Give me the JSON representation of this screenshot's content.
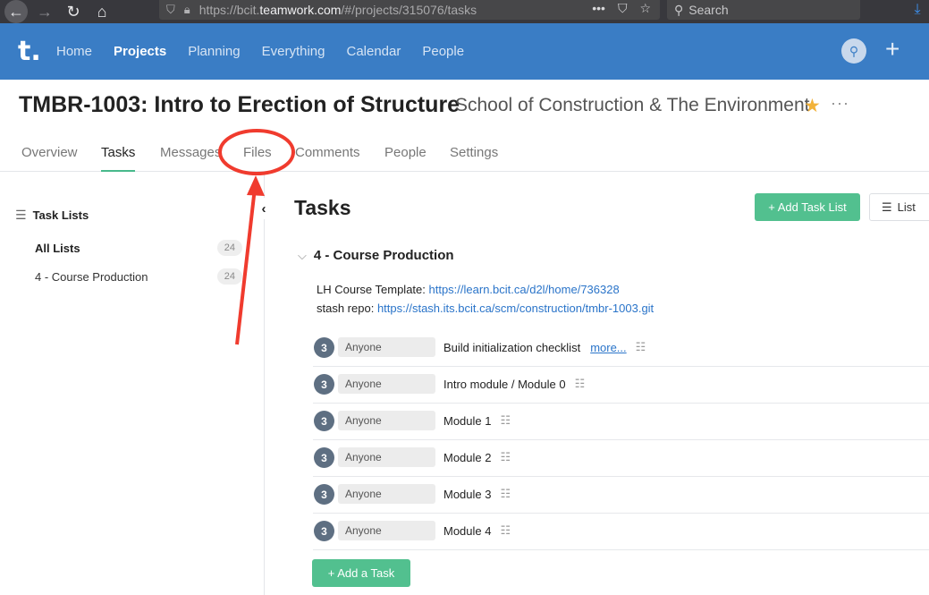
{
  "browser": {
    "back_icon": "←",
    "forward_icon": "→",
    "reload_icon": "↻",
    "home_icon": "⌂",
    "url_prefix": "https://bcit.",
    "url_domain": "teamwork.com",
    "url_rest": "/#/projects/315076/tasks",
    "url_actions": [
      "•••",
      "⛉",
      "☆"
    ],
    "search_placeholder": "Search",
    "download_icon": "⤓"
  },
  "header": {
    "logo": "t.",
    "nav": [
      {
        "label": "Home",
        "active": false
      },
      {
        "label": "Projects",
        "active": true
      },
      {
        "label": "Planning",
        "active": false
      },
      {
        "label": "Everything",
        "active": false
      },
      {
        "label": "Calendar",
        "active": false
      },
      {
        "label": "People",
        "active": false
      }
    ],
    "plus": "+"
  },
  "project": {
    "title": "TMBR-1003: Intro to Erection of Structure",
    "company": "School of Construction & The Environment",
    "star": "★",
    "more": "···"
  },
  "tabs": [
    {
      "label": "Overview",
      "active": false
    },
    {
      "label": "Tasks",
      "active": true
    },
    {
      "label": "Messages",
      "active": false
    },
    {
      "label": "Files",
      "active": false
    },
    {
      "label": "Comments",
      "active": false
    },
    {
      "label": "People",
      "active": false
    },
    {
      "label": "Settings",
      "active": false
    }
  ],
  "sidebar": {
    "heading": "Task Lists",
    "items": [
      {
        "label": "All Lists",
        "count": "24"
      },
      {
        "label": "4 - Course Production",
        "count": "24"
      }
    ],
    "collapse": "‹"
  },
  "main": {
    "title": "Tasks",
    "add_list_label": "+ Add Task List",
    "view_label": "List",
    "tasklist": {
      "name": "4 - Course Production",
      "desc1_label": "LH Course Template: ",
      "desc1_link": "https://learn.bcit.ca/d2l/home/736328",
      "desc2_label": "stash repo: ",
      "desc2_link": "https://stash.its.bcit.ca/scm/construction/tmbr-1003.git"
    },
    "tasks": [
      {
        "badge": "3",
        "assignee": "Anyone",
        "name": "Build initialization checklist",
        "more": "more..."
      },
      {
        "badge": "3",
        "assignee": "Anyone",
        "name": "Intro module / Module 0",
        "more": ""
      },
      {
        "badge": "3",
        "assignee": "Anyone",
        "name": "Module 1",
        "more": ""
      },
      {
        "badge": "3",
        "assignee": "Anyone",
        "name": "Module 2",
        "more": ""
      },
      {
        "badge": "3",
        "assignee": "Anyone",
        "name": "Module 3",
        "more": ""
      },
      {
        "badge": "3",
        "assignee": "Anyone",
        "name": "Module 4",
        "more": ""
      }
    ],
    "add_task_label": "+ Add a Task"
  },
  "colors": {
    "header_blue": "#3a7dc5",
    "accent_green": "#52c08f",
    "annotation_red": "#f03b2e"
  }
}
